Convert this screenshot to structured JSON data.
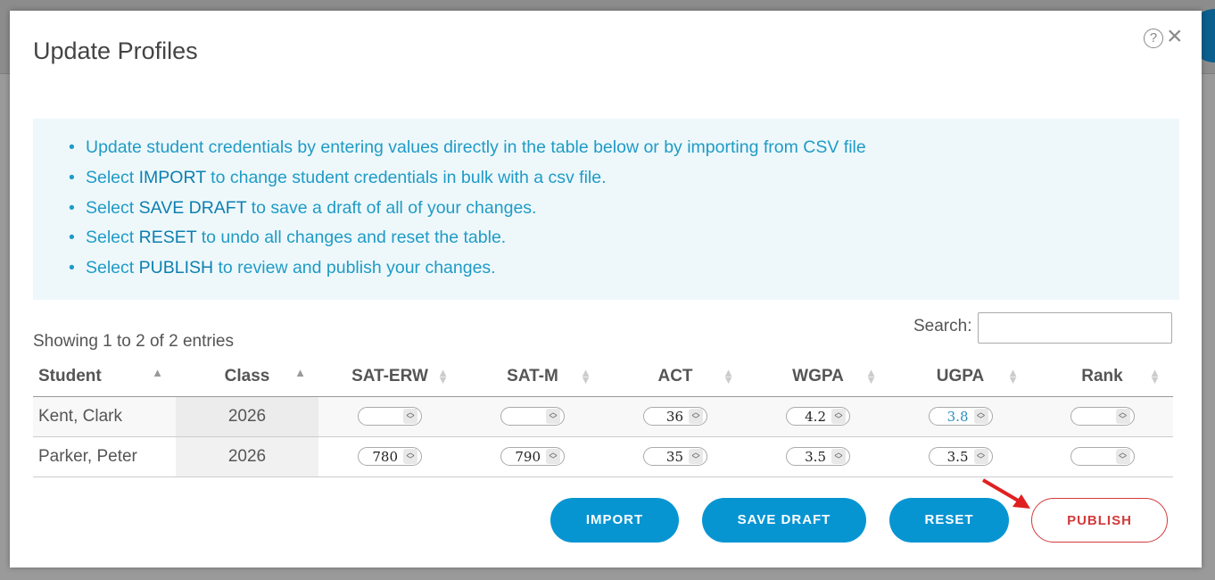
{
  "modal": {
    "title": "Update Profiles",
    "help_icon": "?",
    "close_icon": "×"
  },
  "info": {
    "items": [
      {
        "pre": "Update student credentials by entering values directly in the table below or by importing from CSV file",
        "bold": "",
        "post": ""
      },
      {
        "pre": "Select ",
        "bold": "IMPORT",
        "post": " to change student credentials in bulk with a csv file."
      },
      {
        "pre": "Select ",
        "bold": "SAVE DRAFT",
        "post": " to save a draft of all of your changes."
      },
      {
        "pre": "Select ",
        "bold": "RESET",
        "post": " to undo all changes and reset the table."
      },
      {
        "pre": "Select ",
        "bold": "PUBLISH",
        "post": " to review and publish your changes."
      }
    ]
  },
  "search": {
    "label": "Search:",
    "value": ""
  },
  "table": {
    "showing": "Showing 1 to 2 of 2 entries",
    "columns": [
      "Student",
      "Class",
      "SAT-ERW",
      "SAT-M",
      "ACT",
      "WGPA",
      "UGPA",
      "Rank"
    ],
    "rows": [
      {
        "student": "Kent, Clark",
        "class": "2026",
        "sat_erw": "",
        "sat_m": "",
        "act": "36",
        "wgpa": "4.2",
        "ugpa": "3.8",
        "rank": ""
      },
      {
        "student": "Parker, Peter",
        "class": "2026",
        "sat_erw": "780",
        "sat_m": "790",
        "act": "35",
        "wgpa": "3.5",
        "ugpa": "3.5",
        "rank": ""
      }
    ]
  },
  "buttons": {
    "import": "IMPORT",
    "save_draft": "SAVE DRAFT",
    "reset": "RESET",
    "publish": "PUBLISH"
  },
  "colors": {
    "accent": "#0795d2",
    "info_text": "#1f9bc6",
    "info_bg": "#eef8fb",
    "publish": "#d23a3a"
  }
}
